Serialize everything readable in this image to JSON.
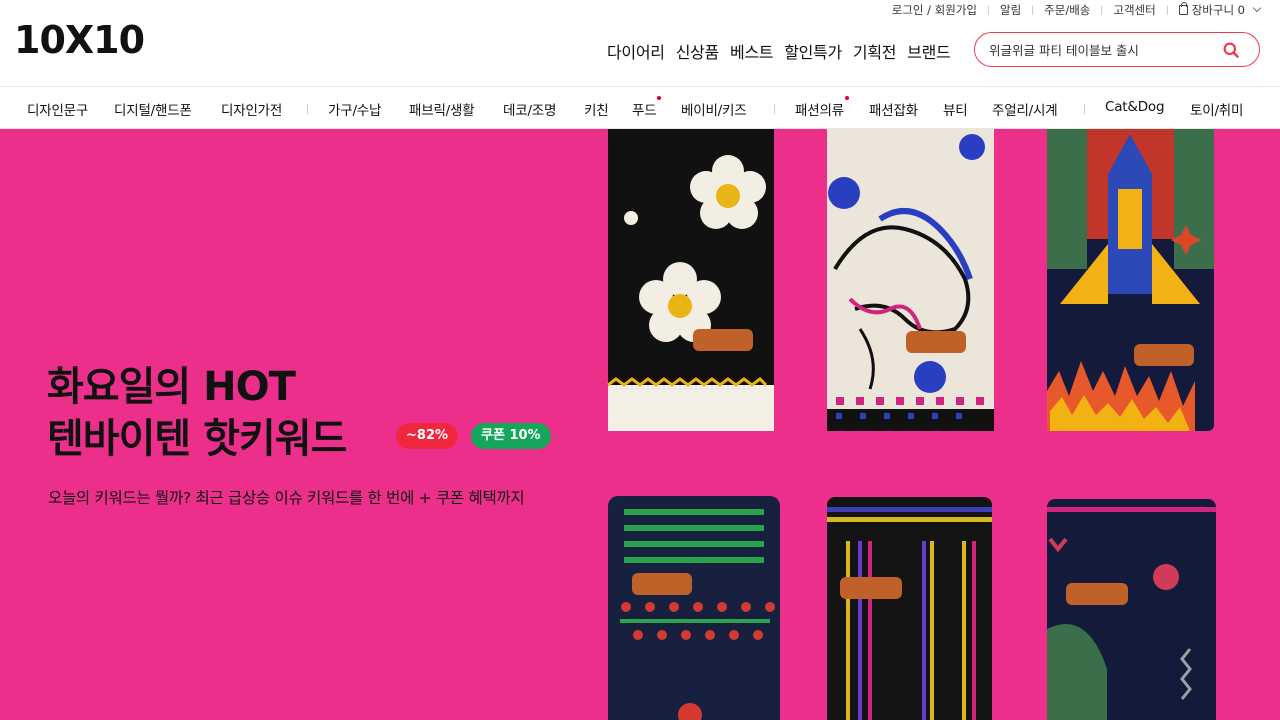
{
  "brand": {
    "logo_text": "10X10"
  },
  "util": {
    "login": "로그인 / 회원가입",
    "alarm": "알림",
    "orders": "주문/배송",
    "cs": "고객센터",
    "cart": "장바구니 0"
  },
  "mainnav": [
    "다이어리",
    "신상품",
    "베스트",
    "할인특가",
    "기획전",
    "브랜드"
  ],
  "search": {
    "placeholder": "위글위글 파티 테이블보 출시"
  },
  "categories": [
    {
      "label": "디자인문구"
    },
    {
      "label": "디지털/핸드폰"
    },
    {
      "label": "디자인가전"
    },
    {
      "label": "가구/수납"
    },
    {
      "label": "패브릭/생활"
    },
    {
      "label": "데코/조명"
    },
    {
      "label": "키친"
    },
    {
      "label": "푸드"
    },
    {
      "label": "베이비/키즈"
    },
    {
      "label": "패션의류"
    },
    {
      "label": "패션잡화"
    },
    {
      "label": "뷰티"
    },
    {
      "label": "주얼리/시계"
    },
    {
      "label": "Cat&Dog"
    },
    {
      "label": "토이/취미"
    }
  ],
  "hero": {
    "title_line1": "화요일의 HOT",
    "title_line2": "텐바이텐 핫키워드",
    "badge_discount": "~82%",
    "badge_coupon": "쿠폰 10%",
    "description": "오늘의 키워드는 뭘까? 최근 급상승 이슈 키워드를 한 번에 + 쿠폰 혜택까지",
    "background_color": "#eb2f8b"
  },
  "colors": {
    "accent": "#ef3a55",
    "new_dot": "#e4002b",
    "badge_red": "#f0283f",
    "badge_green": "#16a65b"
  }
}
